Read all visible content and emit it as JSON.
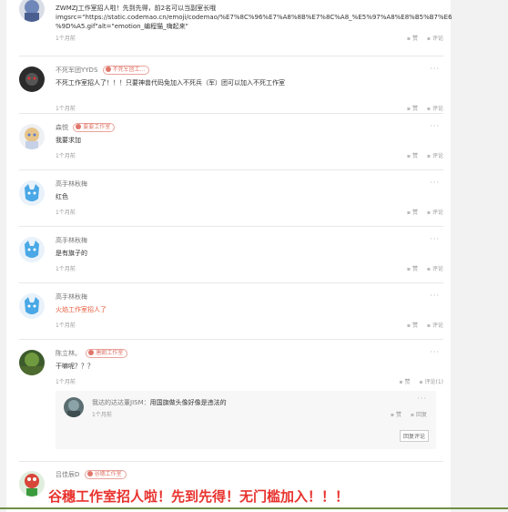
{
  "comments": [
    {
      "author": "",
      "badge": "",
      "text_lines": [
        "ZWMZJ工作室招人啦！先到先得，前2名可以当副室长哦",
        "imgsrc=\"https://static.codemao.cn/emoji/codemao/%E7%8C%96%E7%A8%8B%E7%8C%A8_%E5%97%A8%E8%B5%B7%E6",
        "%9D%A5.gif\"alt=\"emotion_编程猫_嗨起来\""
      ],
      "time": "1个月前",
      "like_label": "赞",
      "comment_label": "评论"
    },
    {
      "author": "不死军团YYDS",
      "badge": "不死军团工...",
      "text_lines": [
        "不死工作室招人了！！！只要神兽代码免加入不死兵（军）团可以加入不死工作室"
      ],
      "time": "1个月前",
      "like_label": "赞",
      "comment_label": "评论"
    },
    {
      "author": "森悦",
      "badge": "要要工作室",
      "text_lines": [
        "我要求加"
      ],
      "time": "1个月前",
      "like_label": "赞",
      "comment_label": "评论"
    },
    {
      "author": "高手林秋梅",
      "badge": "",
      "text_lines": [
        "红色"
      ],
      "time": "1个月前",
      "like_label": "赞",
      "comment_label": "评论"
    },
    {
      "author": "高手林秋梅",
      "badge": "",
      "text_lines": [
        "是有旗子的"
      ],
      "time": "1个月前",
      "like_label": "赞",
      "comment_label": "评论"
    },
    {
      "author": "高手林秋梅",
      "badge": "",
      "text_lines": [
        "火焰工作室招人了"
      ],
      "time": "1个月前",
      "like_label": "赞",
      "comment_label": "评论"
    },
    {
      "author": "陈立林。",
      "badge": "唐朝工作室",
      "text_lines": [
        "干嘛呢？？？"
      ],
      "time": "1个月前",
      "like_label": "赞",
      "comment_label": "评论(1)"
    },
    {
      "author": "吕佳辰D",
      "badge": "谷穗工作室",
      "text_lines": [],
      "time": "",
      "like_label": "",
      "comment_label": ""
    }
  ],
  "reply": {
    "author": "我达的达达董JISM",
    "text": "用国旗做头像好像是违法的",
    "time": "1个月前",
    "like_label": "赞",
    "reply_label": "回复",
    "reply_button": "回复评论"
  },
  "big_text": "谷穗工作室招人啦！先到先得！无门槛加入！！！",
  "more_glyph": "···"
}
